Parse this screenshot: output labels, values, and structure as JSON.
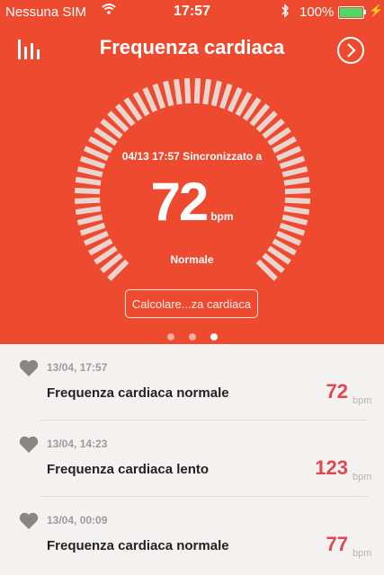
{
  "status_bar": {
    "carrier": "Nessuna SIM",
    "time": "17:57",
    "battery": "100%"
  },
  "header": {
    "title": "Frequenza cardiaca"
  },
  "gauge": {
    "sync_text": "04/13 17:57 Sincronizzato a",
    "value": "72",
    "unit": "bpm",
    "state": "Normale",
    "calc_button": "Calcolare...za cardiaca"
  },
  "pager": {
    "count": 3,
    "active": 2
  },
  "records": [
    {
      "datetime": "13/04, 17:57",
      "label": "Frequenza cardiaca normale",
      "value": "72",
      "unit": "bpm"
    },
    {
      "datetime": "13/04, 14:23",
      "label": "Frequenza cardiaca lento",
      "value": "123",
      "unit": "bpm"
    },
    {
      "datetime": "13/04, 00:09",
      "label": "Frequenza cardiaca normale",
      "value": "77",
      "unit": "bpm"
    }
  ],
  "colors": {
    "header_bg": "#ee4a30",
    "value_red": "#e0474f",
    "list_bg": "#f4f2f1"
  }
}
